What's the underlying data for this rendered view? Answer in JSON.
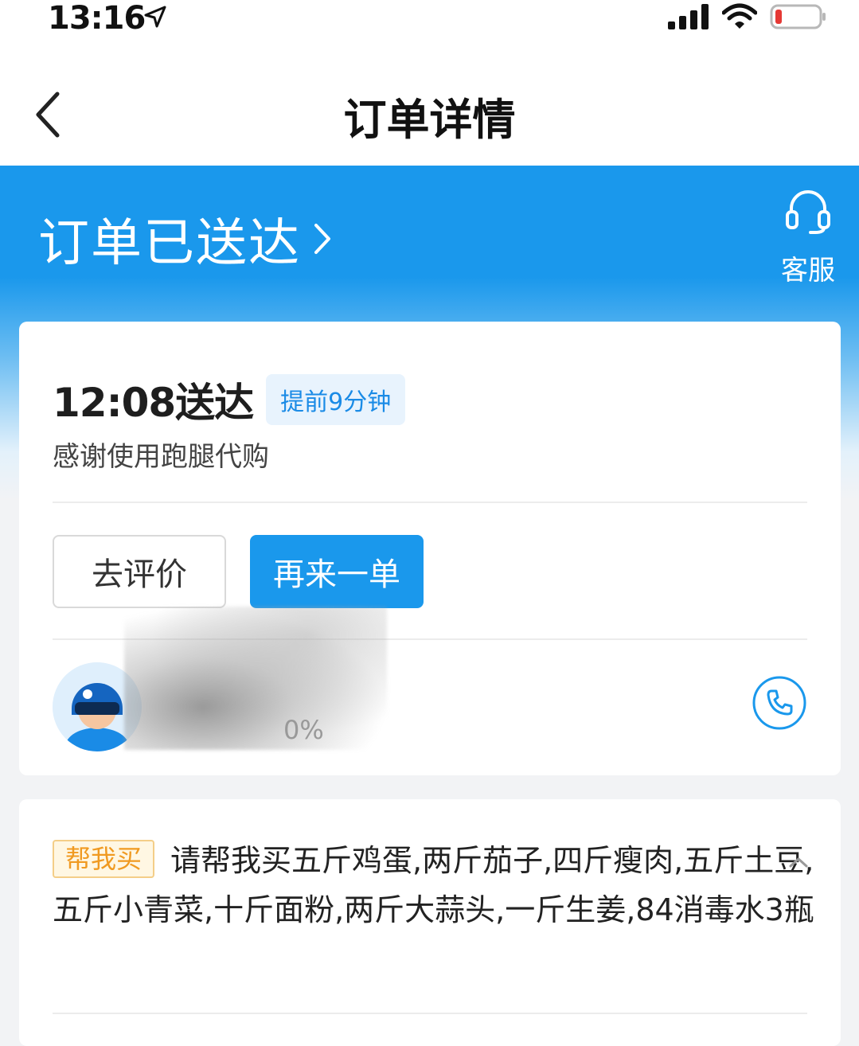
{
  "status_bar": {
    "time": "13:16",
    "location_icon": "location-arrow-icon",
    "signal_icon": "cellular-signal-icon",
    "wifi_icon": "wifi-icon",
    "battery_icon": "battery-low-icon",
    "battery_color": "#e53935"
  },
  "nav": {
    "back_icon": "chevron-left-icon",
    "title": "订单详情"
  },
  "header": {
    "background_color": "#1a98ec",
    "status_text": "订单已送达",
    "status_chevron_icon": "chevron-right-icon",
    "service_icon": "headset-icon",
    "service_label": "客服"
  },
  "delivery_card": {
    "delivered_time": "12:08送达",
    "early_badge": "提前9分钟",
    "thanks_text": "感谢使用跑腿代购",
    "buttons": {
      "review": "去评价",
      "reorder": "再来一单"
    },
    "rider": {
      "avatar_icon": "rider-avatar-icon",
      "rating_text": "0%",
      "phone_icon": "phone-icon"
    }
  },
  "items_card": {
    "tag": "帮我买",
    "description": "请帮我买五斤鸡蛋,两斤茄子,四斤瘦肉,五斤土豆,五斤小青菜,十斤面粉,两斤大蒜头,一斤生姜,84消毒水3瓶",
    "collapse_icon": "chevron-up-icon"
  }
}
